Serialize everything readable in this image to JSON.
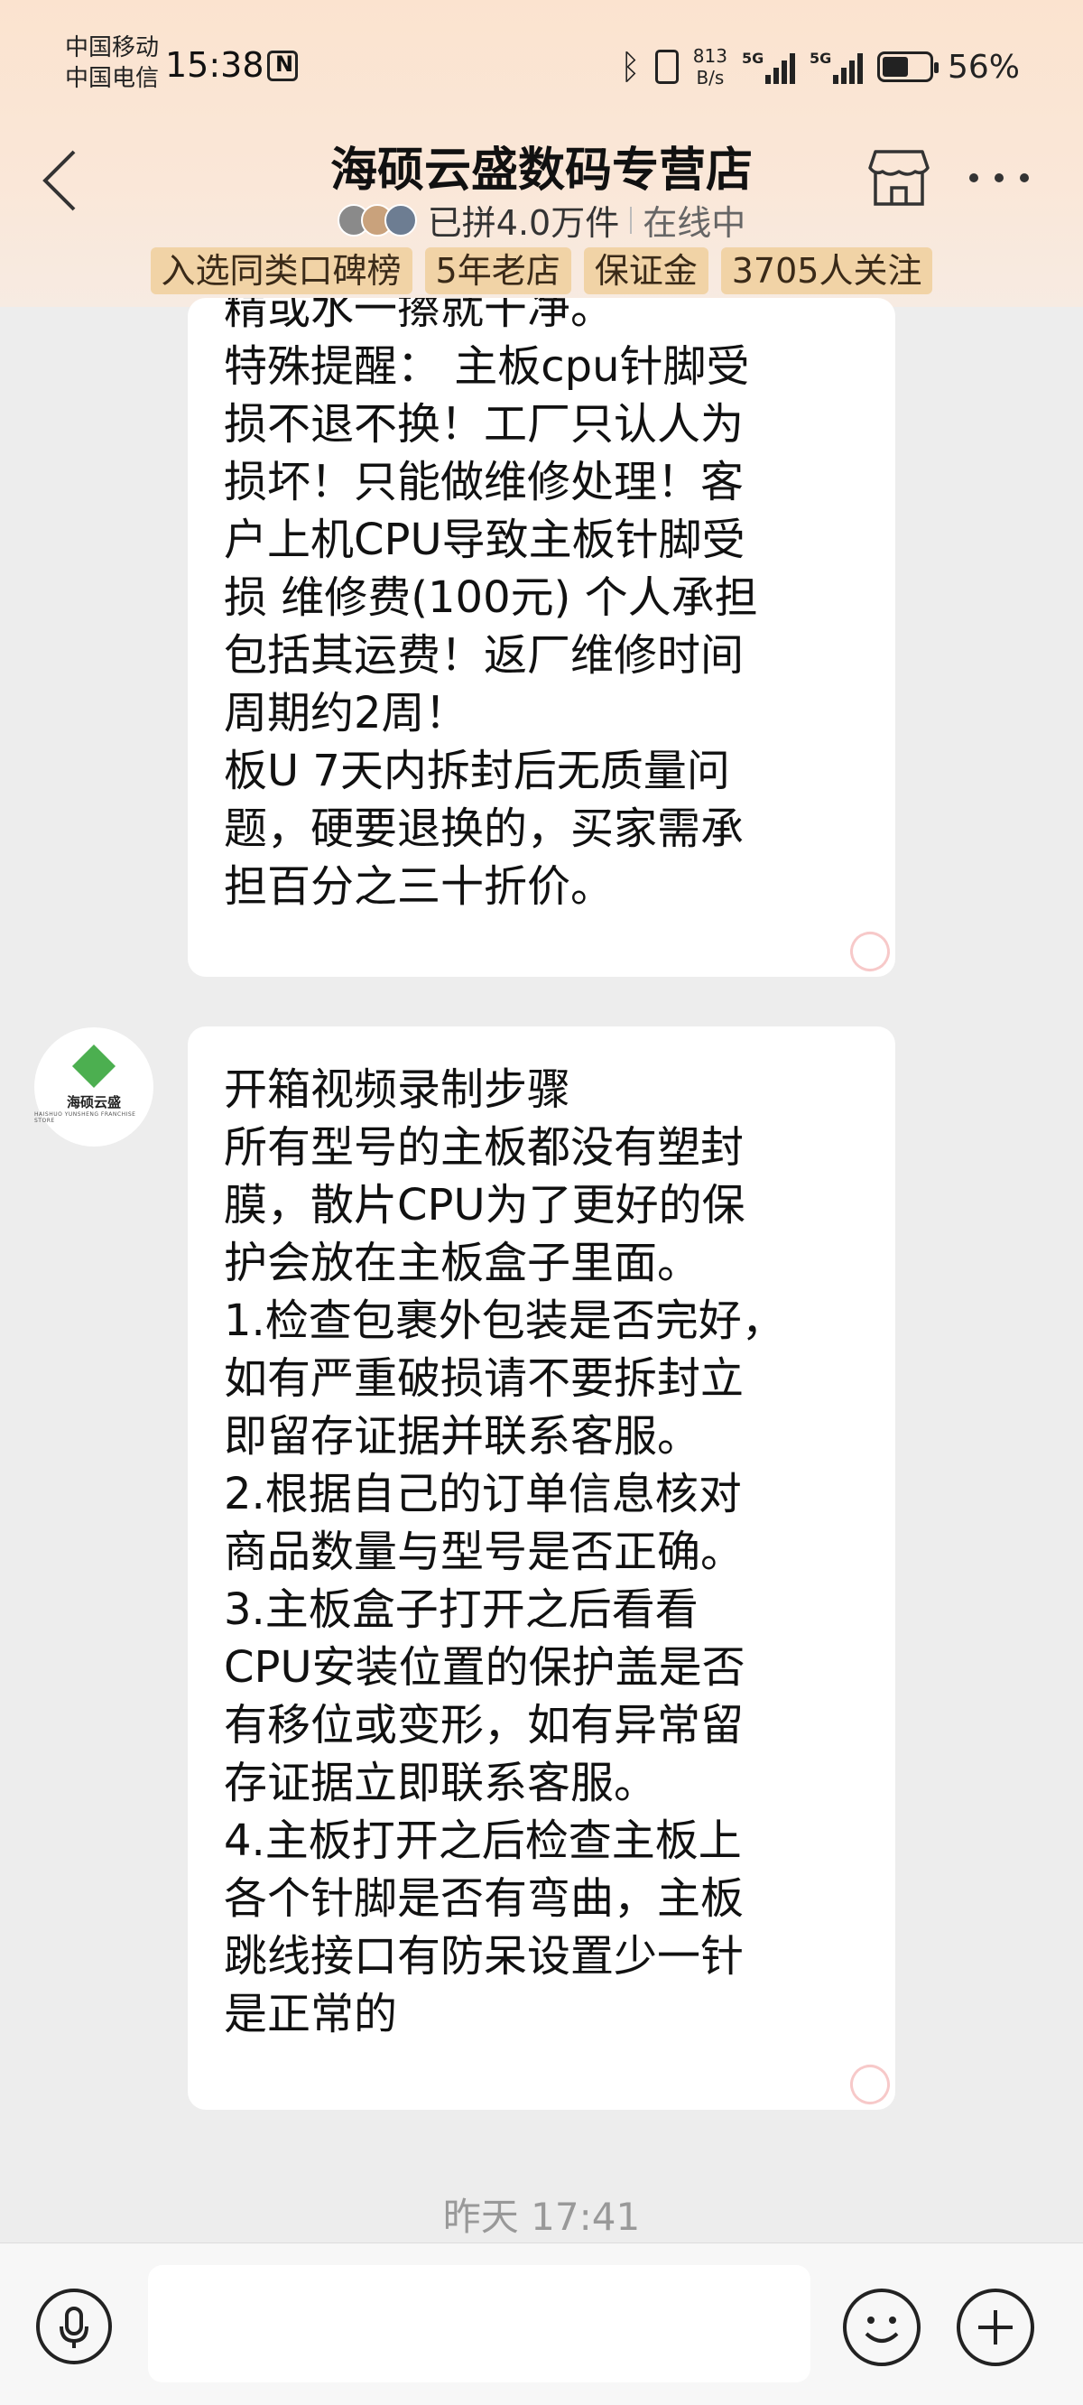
{
  "status_bar": {
    "carrier_1": "中国移动",
    "carrier_2": "中国电信",
    "time": "15:38",
    "net_speed_value": "813",
    "net_speed_unit": "B/s",
    "network_1": "5G",
    "network_2": "5G",
    "battery_level": 0.56,
    "battery_text": "56%"
  },
  "header": {
    "shop_name": "海硕云盛数码专营店",
    "sales_text": "已拼4.0万件",
    "online_text": "在线中",
    "badges": [
      "入选同类口碑榜",
      "5年老店",
      "保证金",
      "3705人关注"
    ]
  },
  "messages": [
    {
      "lines": [
        "精或水一擦就干净。",
        "特殊提醒： 主板cpu针脚受",
        "损不退不换！工厂只认人为",
        "损坏！只能做维修处理！客",
        "户上机CPU导致主板针脚受",
        "损 维修费(100元) 个人承担",
        "包括其运费！返厂维修时间",
        "周期约2周！",
        "板U 7天内拆封后无质量问",
        "题，硬要退换的，买家需承",
        "担百分之三十折价。"
      ]
    },
    {
      "sender_logo_text": "海硕云盛",
      "sender_logo_subtext": "HAISHUO YUNSHENG FRANCHISE STORE",
      "lines": [
        "开箱视频录制步骤",
        "所有型号的主板都没有塑封",
        "膜，散片CPU为了更好的保",
        "护会放在主板盒子里面。",
        "1.检查包裹外包装是否完好，",
        "如有严重破损请不要拆封立",
        "即留存证据并联系客服。",
        "2.根据自己的订单信息核对",
        "商品数量与型号是否正确。",
        "3.主板盒子打开之后看看",
        "CPU安装位置的保护盖是否",
        "有移位或变形，如有异常留",
        "存证据立即联系客服。",
        "4.主板打开之后检查主板上",
        "各个针脚是否有弯曲，主板",
        "跳线接口有防呆设置少一针",
        "是正常的"
      ]
    }
  ],
  "timestamp": "昨天 17:41",
  "input": {
    "value": "",
    "placeholder": ""
  },
  "icons": {
    "back": "chevron-left-icon",
    "store": "store-icon",
    "more": "more-horizontal-icon",
    "mic": "microphone-icon",
    "emoji": "emoji-icon",
    "plus": "plus-icon"
  },
  "colors": {
    "header_gradient_top": "#fbe3cf",
    "badge_bg": "#f1d3a6",
    "chat_bg": "#ededed",
    "bubble_bg": "#ffffff",
    "logo_green": "#4caf50"
  }
}
